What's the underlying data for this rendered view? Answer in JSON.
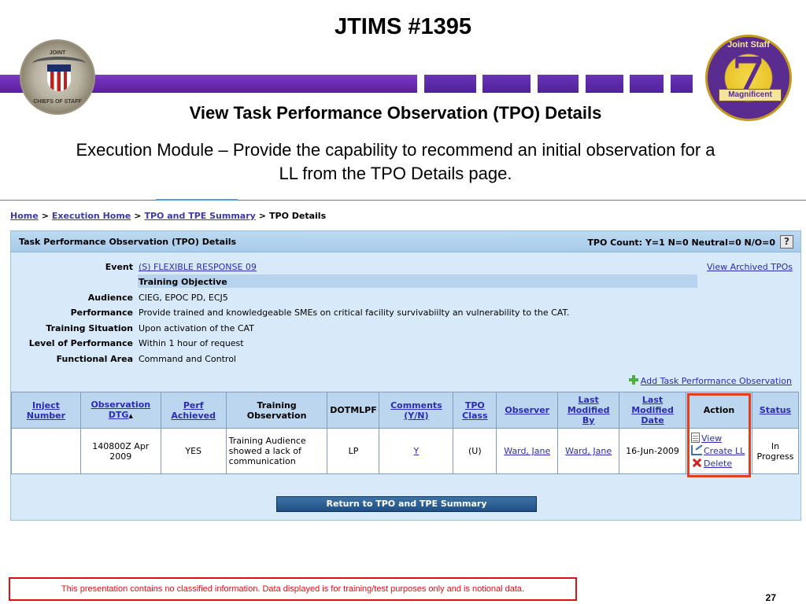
{
  "slide": {
    "title": "JTIMS #1395",
    "subtitle": "View Task Performance Observation (TPO) Details",
    "description": "Execution Module – Provide the capability to recommend an initial observation for a LL from the TPO Details page.",
    "left_seal_text_top": "JOINT",
    "left_seal_text_bottom": "CHIEFS OF STAFF",
    "right_seal_text_top": "Joint Staff",
    "right_seal_number": "7",
    "right_seal_banner": "Magnificent",
    "disclaimer": "This presentation contains no classified information.  Data displayed is for training/test purposes only and is notional data.",
    "page_number": "27",
    "colors": {
      "bar": "#6b2bb2",
      "highlight": "#e04020",
      "disclaimer": "#e01010"
    }
  },
  "breadcrumb": {
    "home": "Home",
    "execution_home": "Execution Home",
    "tpo_tpe_summary": "TPO and TPE Summary",
    "current": "TPO Details",
    "separator": ">"
  },
  "panel": {
    "title": "Task Performance Observation (TPO) Details",
    "tpo_count": "TPO Count: Y=1 N=0 Neutral=0 N/O=0",
    "help_icon": "?",
    "archived_link": "View Archived TPOs",
    "details": {
      "event_label": "Event",
      "event_value": "(S) FLEXIBLE RESPONSE 09",
      "training_objective_value": "Training Objective",
      "audience_label": "Audience",
      "audience_value": "CIEG, EPOC PD, ECJ5",
      "performance_label": "Performance",
      "performance_value": "Provide trained and knowledgeable SMEs on critical facility survivabiilty an vulnerability to the CAT.",
      "situation_label": "Training Situation",
      "situation_value": "Upon activation of the CAT",
      "level_label": "Level of Performance",
      "level_value": "Within 1 hour of request",
      "area_label": "Functional Area",
      "area_value": "Command and Control"
    },
    "add_link": "Add Task Performance Observation",
    "return_button": "Return to TPO and TPE Summary"
  },
  "table": {
    "headers": {
      "inject_1": "Inject",
      "inject_2": "Number",
      "obs_1": "Observation",
      "obs_2": "DTG",
      "perf_1": "Perf",
      "perf_2": "Achieved",
      "train_1": "Training",
      "train_2": "Observation",
      "dotmlpf": "DOTMLPF",
      "comments_1": "Comments",
      "comments_2": "(Y/N)",
      "class_1": "TPO",
      "class_2": "Class",
      "observer": "Observer",
      "lmb_1": "Last",
      "lmb_2": "Modified",
      "lmb_3": "By",
      "lmd_1": "Last",
      "lmd_2": "Modified",
      "lmd_3": "Date",
      "action": "Action",
      "status": "Status"
    },
    "row": {
      "inject_number": "",
      "observation_dtg": "140800Z Apr 2009",
      "perf_achieved": "YES",
      "training_observation": "Training Audience showed a lack of communication",
      "dotmlpf": "LP",
      "comments": "Y",
      "tpo_class": "(U)",
      "observer": "Ward, Jane",
      "last_modified_by": "Ward, Jane",
      "last_modified_date": "16-Jun-2009",
      "action_view": "View",
      "action_create": "Create LL",
      "action_delete": "Delete",
      "status": "In Progress"
    }
  }
}
